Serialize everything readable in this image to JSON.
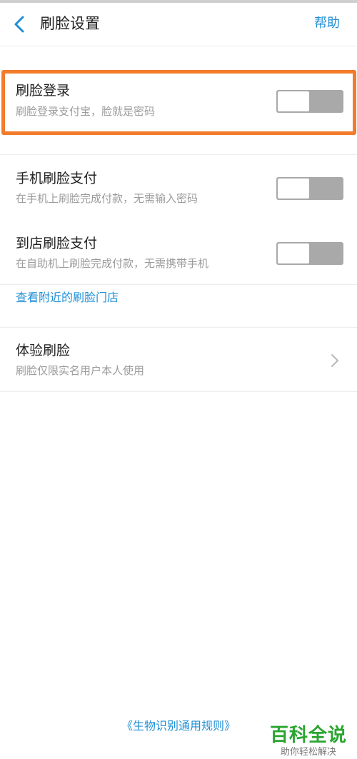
{
  "header": {
    "title": "刷脸设置",
    "help_label": "帮助"
  },
  "settings": [
    {
      "title": "刷脸登录",
      "subtitle": "刷脸登录支付宝，脸就是密码",
      "toggle_on": false
    },
    {
      "title": "手机刷脸支付",
      "subtitle": "在手机上刷脸完成付款，无需输入密码",
      "toggle_on": false
    },
    {
      "title": "到店刷脸支付",
      "subtitle": "在自助机上刷脸完成付款，无需携带手机",
      "toggle_on": false
    }
  ],
  "nearby_stores_link": "查看附近的刷脸门店",
  "experience": {
    "title": "体验刷脸",
    "subtitle": "刷脸仅限实名用户本人使用"
  },
  "footer_link": "《生物识别通用规则》",
  "watermark": {
    "title": "百科全说",
    "subtitle": "助你轻松解决"
  },
  "colors": {
    "accent": "#1f8fd6",
    "highlight_border": "#f27b2c",
    "toggle_off": "#a9a9a9",
    "watermark_green": "#2aa52f"
  },
  "icons": [
    "back-arrow-icon",
    "chevron-right-icon"
  ]
}
